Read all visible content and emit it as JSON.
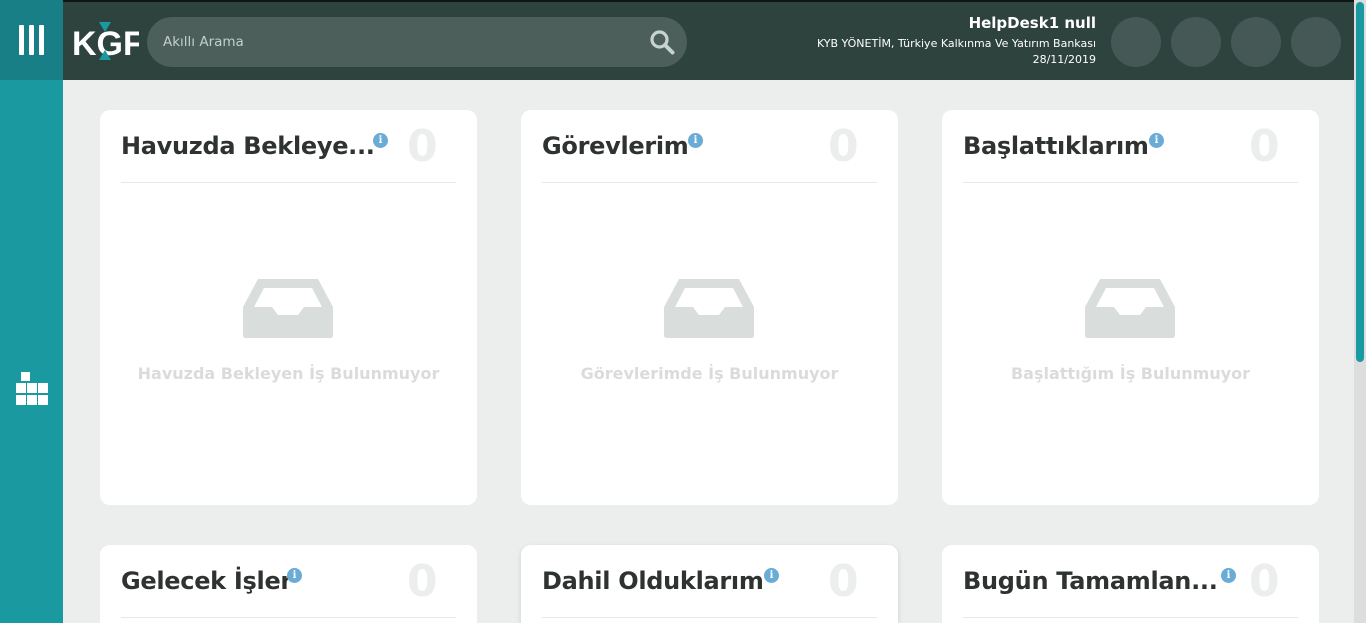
{
  "header": {
    "logo_text": "KGF",
    "search_placeholder": "Akıllı Arama",
    "user": {
      "name": "HelpDesk1 null",
      "organization": "KYB YÖNETİM, Türkiye Kalkınma Ve Yatırım Bankası",
      "date": "28/11/2019"
    },
    "action_buttons": 4
  },
  "cards": [
    {
      "title": "Havuzda Bekleye...",
      "count": "0",
      "empty_text": "Havuzda Bekleyen İş Bulunmuyor"
    },
    {
      "title": "Görevlerim",
      "count": "0",
      "empty_text": "Görevlerimde İş Bulunmuyor"
    },
    {
      "title": "Başlattıklarım",
      "count": "0",
      "empty_text": "Başlattığım İş Bulunmuyor"
    },
    {
      "title": "Gelecek İşler",
      "count": "0"
    },
    {
      "title": "Dahil Olduklarım",
      "count": "0"
    },
    {
      "title": "Bugün Tamamlan...",
      "count": "0"
    }
  ],
  "colors": {
    "rail": "#1a9aa0",
    "header": "#2e423e",
    "info": "#6aacd6",
    "background": "#eceeed"
  },
  "icons": {
    "menu": "hamburger-menu-icon",
    "module": "boxes-icon",
    "search": "search-icon",
    "info": "info-icon",
    "empty": "inbox-tray-icon"
  }
}
